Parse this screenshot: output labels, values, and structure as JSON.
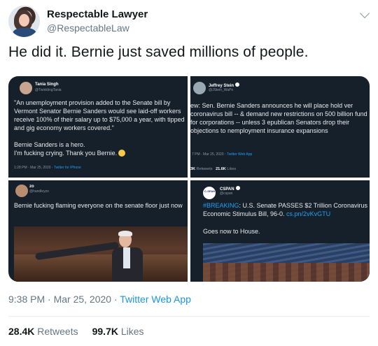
{
  "author": {
    "display_name": "Respectable Lawyer",
    "handle": "@RespectableLaw"
  },
  "tweet": {
    "text": "He did it. Bernie just saved millions of people.",
    "time": "9:38 PM · Mar 25, 2020 · ",
    "source": "Twitter Web App",
    "retweets_count": "28.4K",
    "retweets_label": " Retweets",
    "likes_count": "99.7K",
    "likes_label": " Likes"
  },
  "media": {
    "panel1": {
      "name": "Tania Singh",
      "handle": "@TwinklingTania",
      "text": "\"An unemployment provision added to the Senate bill by Vermont Senator Bernie Sanders would see laid-off workers receive 100% of their salary up to $75,000 a year, with tipped and gig economy workers covered.\"\n\nBernie Sanders is a hero.\nI'm fucking crying. Thank you Bernie.",
      "meta": "1:28 PM · Mar 25, 2020 · ",
      "meta_source": "Twitter for iPhone"
    },
    "panel2": {
      "name": "Jeffrey Stein",
      "handle": "@JStein_WaPo",
      "text": "ew: Sen. Bernie Sanders announces he will place hold ver coronavirus bill -- & demand new restrictions on 500 billion fund for corporations -- unless 3 epublican Senators drop their objections to nemployment insurance expansions",
      "meta": "7 PM · Mar 25, 2020 · ",
      "meta_source": "Twitter Web App",
      "retweets": "3K",
      "retweets_label": " Retweets",
      "likes": "21.6K",
      "likes_label": " Likes"
    },
    "panel3": {
      "name": "zo",
      "handle": "@handleyzo",
      "text": "Bernie fucking flaming everyone on the senate floor just now"
    },
    "panel4": {
      "logo": "C-SPAN",
      "name": "CSPAN",
      "handle": "@cspan",
      "hashtag": "#BREAKING",
      "text": ": U.S. Senate PASSES $2 Trillion Coronavirus Economic Stimulus Bill, 96-0. ",
      "link": "cs.pn/2vKvGTU",
      "text2": "Goes now to House."
    }
  },
  "icons": {
    "menu": "chevron-down-icon",
    "verified": "verified-badge-icon",
    "emoji": "crying-face-icon"
  },
  "colors": {
    "accent": "#1b95e0",
    "dark_panel": "#15202b",
    "muted": "#657786"
  }
}
